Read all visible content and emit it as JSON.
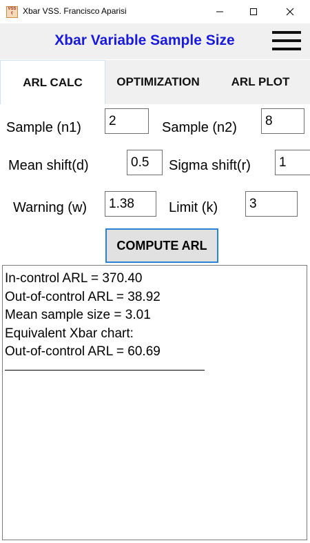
{
  "window": {
    "icon_text": "VSS",
    "title": "Xbar VSS.  Francisco Aparisi"
  },
  "header": {
    "title": "Xbar Variable Sample Size"
  },
  "tabs": [
    {
      "label": "ARL CALC",
      "active": true
    },
    {
      "label": "OPTIMIZATION",
      "active": false
    },
    {
      "label": "ARL PLOT",
      "active": false
    }
  ],
  "form": {
    "sample_n1": {
      "label": "Sample (n1)",
      "value": "2"
    },
    "sample_n2": {
      "label": "Sample (n2)",
      "value": "8"
    },
    "mean_shift": {
      "label": "Mean shift(d)",
      "value": "0.5"
    },
    "sigma_shift": {
      "label": "Sigma shift(r)",
      "value": "1"
    },
    "warning": {
      "label": "Warning (w)",
      "value": "1.38"
    },
    "limit": {
      "label": "Limit (k)",
      "value": "3"
    }
  },
  "compute_button": "COMPUTE ARL",
  "output": {
    "lines": [
      "In-control ARL = 370.40",
      "Out-of-control ARL = 38.92",
      "Mean sample size = 3.01",
      "Equivalent Xbar chart:",
      "Out-of-control ARL = 60.69"
    ]
  },
  "colors": {
    "title_blue": "#1a1adb",
    "button_border": "#2a82d6"
  }
}
